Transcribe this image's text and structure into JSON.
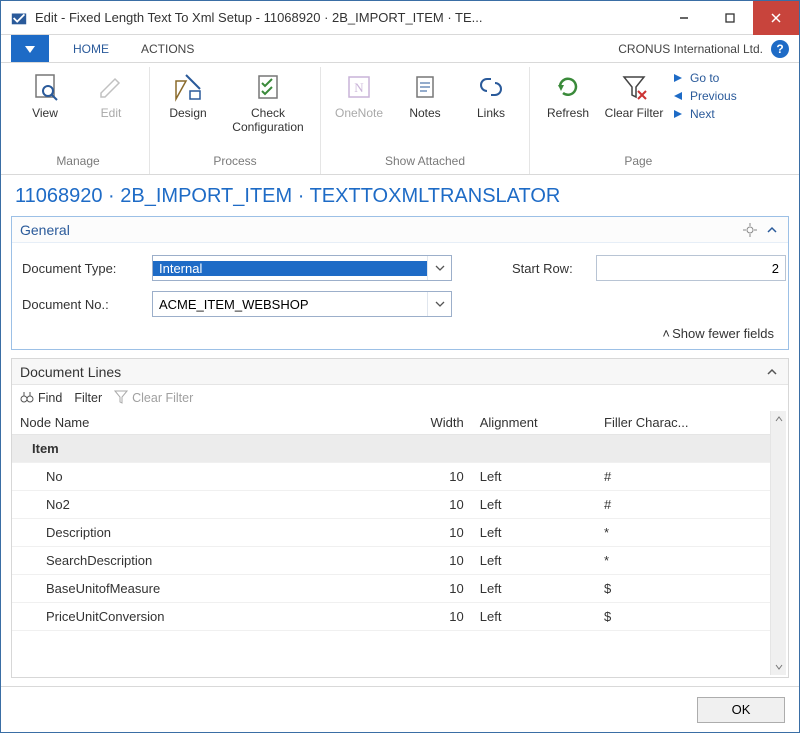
{
  "window": {
    "title": "Edit - Fixed Length Text To Xml Setup - 11068920 · 2B_IMPORT_ITEM · TE..."
  },
  "ribbon": {
    "company": "CRONUS International Ltd.",
    "tabs": {
      "home": "HOME",
      "actions": "ACTIONS"
    },
    "groups": {
      "manage": "Manage",
      "process": "Process",
      "show_attached": "Show Attached",
      "page": "Page"
    },
    "buttons": {
      "view": "View",
      "edit": "Edit",
      "design": "Design",
      "check": "Check Configuration",
      "onenote": "OneNote",
      "notes": "Notes",
      "links": "Links",
      "refresh": "Refresh",
      "clear_filter": "Clear Filter",
      "goto": "Go to",
      "previous": "Previous",
      "next": "Next"
    }
  },
  "page": {
    "title": "11068920 · 2B_IMPORT_ITEM · TEXTTOXMLTRANSLATOR"
  },
  "general": {
    "heading": "General",
    "doc_type_label": "Document Type:",
    "doc_type_value": "Internal",
    "doc_no_label": "Document No.:",
    "doc_no_value": "ACME_ITEM_WEBSHOP",
    "start_row_label": "Start Row:",
    "start_row_value": "2",
    "show_fewer": "Show fewer fields"
  },
  "lines": {
    "heading": "Document Lines",
    "find": "Find",
    "filter": "Filter",
    "clear_filter": "Clear Filter",
    "cols": {
      "node": "Node Name",
      "width": "Width",
      "align": "Alignment",
      "fill": "Filler Charac..."
    },
    "rows": [
      {
        "name": "Item",
        "indent": 1,
        "width": "",
        "align": "",
        "fill": "",
        "selected": true
      },
      {
        "name": "No",
        "indent": 2,
        "width": "10",
        "align": "Left",
        "fill": "#"
      },
      {
        "name": "No2",
        "indent": 2,
        "width": "10",
        "align": "Left",
        "fill": "#"
      },
      {
        "name": "Description",
        "indent": 2,
        "width": "10",
        "align": "Left",
        "fill": "*"
      },
      {
        "name": "SearchDescription",
        "indent": 2,
        "width": "10",
        "align": "Left",
        "fill": "*"
      },
      {
        "name": "BaseUnitofMeasure",
        "indent": 2,
        "width": "10",
        "align": "Left",
        "fill": "$"
      },
      {
        "name": "PriceUnitConversion",
        "indent": 2,
        "width": "10",
        "align": "Left",
        "fill": "$"
      }
    ]
  },
  "footer": {
    "ok": "OK"
  }
}
